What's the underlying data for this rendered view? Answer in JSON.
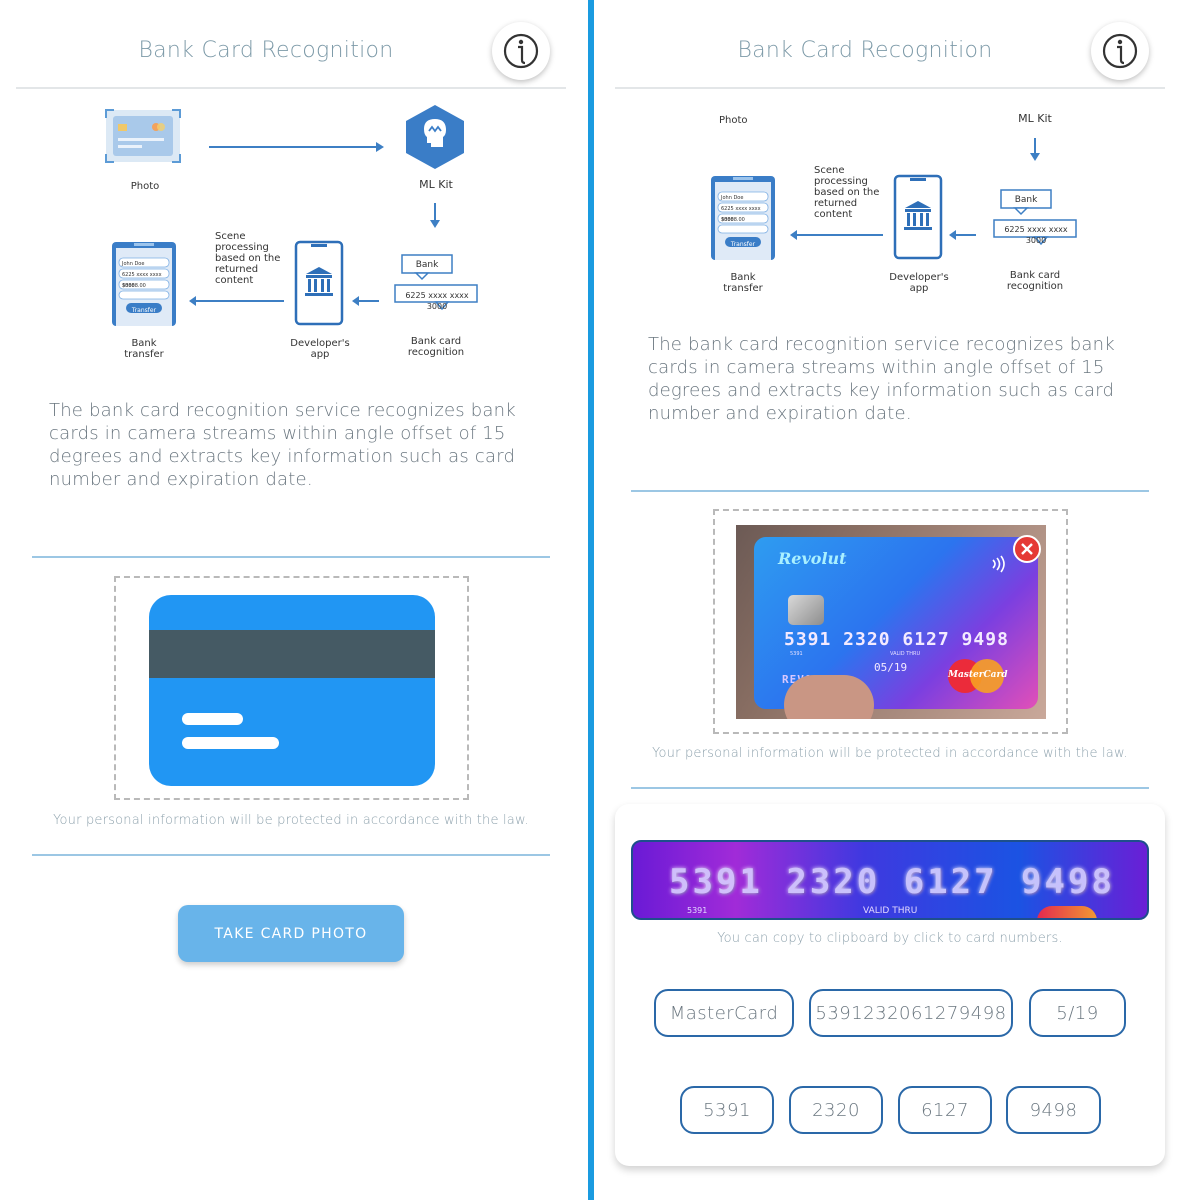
{
  "app": {
    "title": "Bank Card Recognition",
    "info_icon": "info-icon"
  },
  "diagram": {
    "photo_label": "Photo",
    "mlkit_label": "ML Kit",
    "scene_note": "Scene\nprocessing\nbased on the\nreturned\ncontent",
    "bank_transfer_label": "Bank\ntransfer",
    "developer_app_label": "Developer's\napp",
    "bank_card_recognition_label": "Bank card\nrecognition",
    "bubble_bank": "Bank",
    "bubble_number": "6225 xxxx xxxx 3000",
    "phone_name": "John Doe",
    "phone_card": "6225 xxxx xxxx 3000",
    "phone_amount": "$8888.00",
    "phone_button": "Transfer"
  },
  "description": "The bank card recognition service recognizes bank cards in camera streams within angle offset of 15 degrees and extracts key information such as card number and expiration date.",
  "privacy_notice": "Your personal information will be protected in accordance with the law.",
  "take_photo_button": "TAKE CARD PHOTO",
  "captured_card": {
    "brand_text": "Revolut",
    "number_text": "5391 2320 6127 9498",
    "small_number": "5391",
    "valid_thru_label": "VALID THRU",
    "expiry_text": "05/19",
    "holder_text": "REVOLUT",
    "network_logo": "MasterCard"
  },
  "close_icon": "close-icon",
  "crop": {
    "number_text": "5391 2320 6127 9498",
    "small_number": "5391",
    "valid_thru_label": "VALID THRU"
  },
  "copy_hint": "You can copy to clipboard by click to card numbers.",
  "results": {
    "card_type": "MasterCard",
    "card_number": "5391232061279498",
    "expiry": "5/19",
    "number_groups": [
      "5391",
      "2320",
      "6127",
      "9498"
    ]
  },
  "colors": {
    "accent": "#1a9be0",
    "primary_blue": "#2d8ddc",
    "title_gray": "#7d9aa8",
    "chip_border": "#2a68a8",
    "card_blue": "#2196f3",
    "card_stripe": "#455a64",
    "close_red": "#e53935"
  }
}
